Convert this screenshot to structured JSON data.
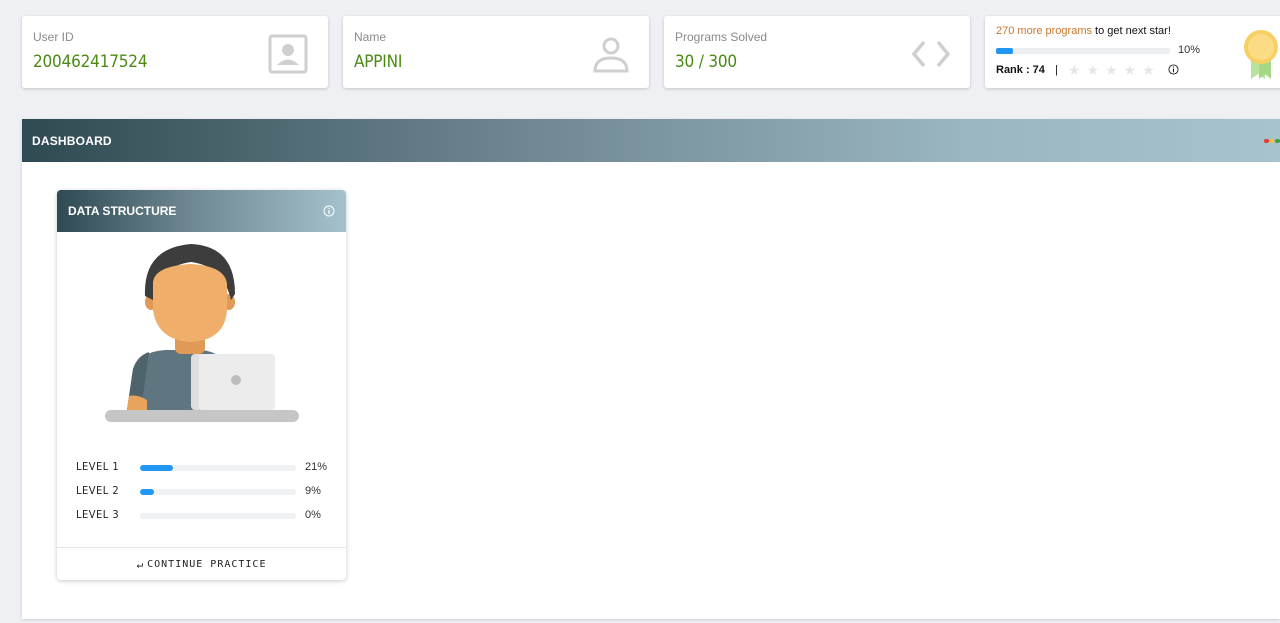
{
  "stats": {
    "user_id": {
      "label": "User ID",
      "value": "200462417524",
      "icon": "contact-card-icon"
    },
    "name": {
      "label": "Name",
      "value": "APPINI",
      "icon": "user-icon"
    },
    "programs": {
      "label": "Programs Solved",
      "value": "30 / 300",
      "icon": "code-brackets-icon"
    }
  },
  "star_card": {
    "highlight": "270 more programs",
    "rest": " to get next star!",
    "progress_percent": 10,
    "progress_label": "10%",
    "rank": "Rank : 74",
    "separator": "|",
    "stars_total": 5,
    "stars_filled": 0,
    "stars_text": "★★★★★"
  },
  "dashboard": {
    "title": "DASHBOARD",
    "status_dot_colors": [
      "#e53935",
      "#fbc02d",
      "#43a047"
    ]
  },
  "data_structure": {
    "title": "DATA STRUCTURE",
    "levels": [
      {
        "name": "LEVEL 1",
        "percent": 21,
        "label": "21%"
      },
      {
        "name": "LEVEL 2",
        "percent": 9,
        "label": "9%"
      },
      {
        "name": "LEVEL 3",
        "percent": 0,
        "label": "0%"
      }
    ],
    "continue_label": "CONTINUE PRACTICE",
    "continue_icon": "↵"
  },
  "colors": {
    "accent_green": "#4a8a12",
    "progress_blue": "#2196f3",
    "highlight_orange": "#c8782e"
  }
}
